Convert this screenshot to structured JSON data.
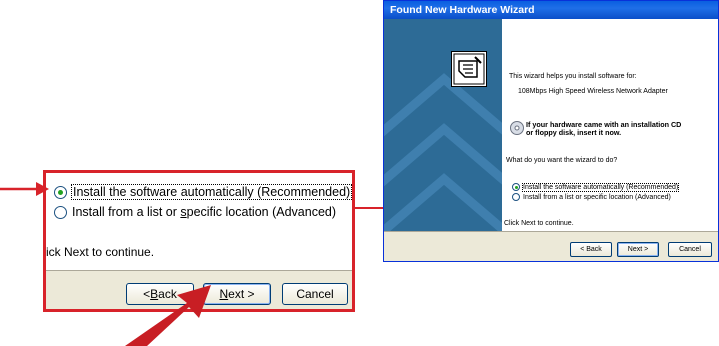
{
  "zoom": {
    "option_auto": "Install the software automatically (Recommended)",
    "option_manual_pre": "Install from a list or ",
    "option_manual_ul": "s",
    "option_manual_post": "pecific location (Advanced)",
    "continue_text": "ick Next to continue.",
    "back_pre": "< ",
    "back_ul": "B",
    "back_post": "ack",
    "next_ul": "N",
    "next_post": "ext >",
    "cancel_label": "Cancel"
  },
  "wizard": {
    "title": "Found New Hardware Wizard",
    "intro": "This wizard helps you install software for:",
    "device": "108Mbps High Speed Wireless Network Adapter",
    "cd_line1": "If your hardware came with an installation CD",
    "cd_line2": "or floppy disk, insert it now.",
    "question": "What do you want the wizard to do?",
    "option_auto": "Install the software automatically (Recommended)",
    "option_manual": "Install from a list or specific location (Advanced)",
    "continue_text": "Click Next to continue.",
    "back_label": "< Back",
    "next_label": "Next >",
    "cancel_label": "Cancel"
  },
  "colors": {
    "callout_red": "#d8232a",
    "xp_title_blue": "#0a5fe0",
    "panel_blue": "#2d6b96"
  }
}
